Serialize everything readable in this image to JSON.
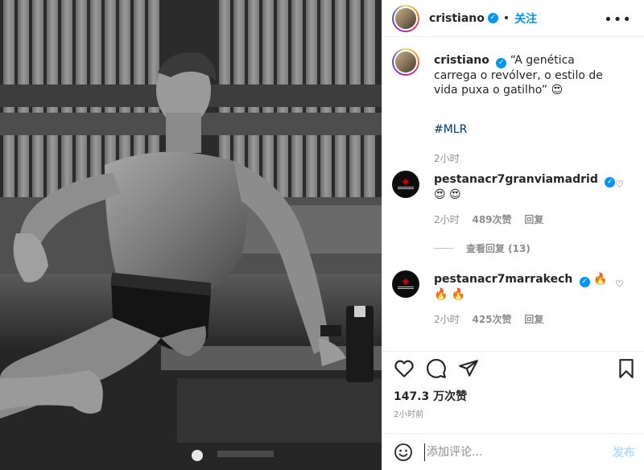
{
  "post": {
    "author": "cristiano",
    "separator": "•",
    "follow_label": "关注",
    "more_icon": "more-horizontal-icon",
    "caption": "“A genética carrega o revólver, o estilo de vida puxa o gatilho”",
    "caption_emoji": "😍",
    "hashtag": "#MLR",
    "caption_time": "2小时",
    "likes": "147.3 万次赞",
    "posted_time": "2小时前"
  },
  "comments": [
    {
      "username": "pestanacr7granviamadrid",
      "text": "😍 😍",
      "time": "2小时",
      "likes": "489次赞",
      "reply_label": "回复",
      "view_replies": "查看回复 (13)"
    },
    {
      "username": "pestanacr7marrakech",
      "text": "🔥 🔥 🔥",
      "time": "2小时",
      "likes": "425次赞",
      "reply_label": "回复"
    }
  ],
  "comment_form": {
    "placeholder": "添加评论...",
    "submit_label": "发布"
  },
  "colors": {
    "accent": "#0095f6",
    "muted": "#8e8e8e",
    "post_disabled": "#b2dffc"
  }
}
